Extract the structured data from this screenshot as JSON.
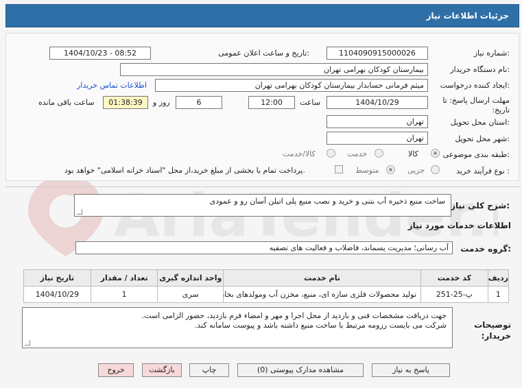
{
  "header": {
    "title": "جزئیات اطلاعات نیاز"
  },
  "form": {
    "need_number": {
      "label": "شماره نیاز:",
      "value": "1104090915000026"
    },
    "announce": {
      "label": "تاریخ و ساعت اعلان عمومی:",
      "value": "1404/10/23 - 08:52"
    },
    "buyer_org": {
      "label": "نام دستگاه خریدار:",
      "value": "بیمارستان کودکان بهرامی تهران"
    },
    "requester": {
      "label": "ایجاد کننده درخواست:",
      "value": "میثم  فرمانی حسابدار بیمارستان کودکان بهرامی تهران"
    },
    "contact_link": "اطلاعات تماس خریدار",
    "deadline": {
      "label": "مهلت ارسال پاسخ: تا تاریخ:",
      "date": "1404/10/29",
      "time_label": "ساعت",
      "time": "12:00",
      "days": "6",
      "days_label": "روز و",
      "remaining": "01:38:39",
      "remaining_label": "ساعت باقی مانده"
    },
    "province": {
      "label": "استان محل تحویل:",
      "value": "تهران"
    },
    "city": {
      "label": "شهر محل تحویل:",
      "value": "تهران"
    },
    "category": {
      "label": "طبقه بندی موضوعی:",
      "options": [
        "کالا",
        "خدمت",
        "کالا/خدمت"
      ]
    },
    "process": {
      "label": "نوع فرآیند خرید :",
      "options": [
        "جزیی",
        "متوسط"
      ],
      "treasury_note": "پرداخت تمام یا بخشی از مبلغ خرید،از محل \"اسناد خزانه اسلامی\" خواهد بود."
    }
  },
  "description": {
    "label": "شرح کلی نیاز:",
    "value": "ساخت منبع ذخیره آب بتنی و خرید و نصب منبع پلی اتیلن آسان رو و عمودی"
  },
  "services_title": "اطلاعات خدمات مورد نیاز",
  "service_group": {
    "label": "گروه خدمت:",
    "value": "آب رسانی؛ مدیریت پسماند، فاضلاب و فعالیت های تصفیه"
  },
  "table": {
    "headers": [
      "ردیف",
      "کد خدمت",
      "نام خدمت",
      "واحد اندازه گیری",
      "تعداد / مقدار",
      "تاریخ نیاز"
    ],
    "rows": [
      [
        "1",
        "پ-25-251",
        "تولید محصولات فلزی سازه ای، منبع، مخزن آب ومولدهای بخار",
        "سری",
        "1",
        "1404/10/29"
      ]
    ]
  },
  "buyer_notes": {
    "label": "توضیحات خریدار:",
    "line1": "جهت دریافت مشخصات فنی و بازدید از محل اجرا و مهر و امضاء فرم بازدید، حضور الزامی است.",
    "line2": "شرکت می بایست رزومه مرتبط با ساخت منبع داشته باشد و پیوست سامانه کند."
  },
  "buttons": {
    "reply": "پاسخ به نیاز",
    "attachments": "مشاهده مدارک پیوستی (0)",
    "print": "چاپ",
    "back": "بازگشت",
    "exit": "خروج"
  },
  "watermark": "AriaTender.net"
}
